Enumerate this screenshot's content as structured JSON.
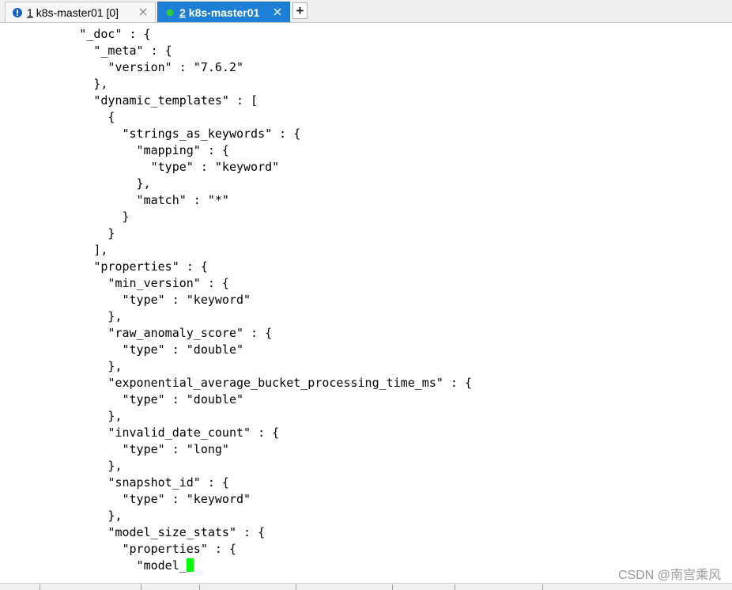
{
  "tabs": [
    {
      "number": "1",
      "label": "k8s-master01 [0]",
      "status_icon": "exclamation-info-icon",
      "status_color": "#1565c0",
      "active": false
    },
    {
      "number": "2",
      "label": "k8s-master01",
      "status_icon": "green-dot-icon",
      "status_color": "#2ecc40",
      "active": true
    }
  ],
  "new_tab_label": "+",
  "colors": {
    "active_tab": "#1e7fd6",
    "cursor": "#00ff00",
    "terminal_bg": "#ffffff",
    "terminal_fg": "#000000"
  },
  "terminal": {
    "lines": [
      "          \"_doc\" : {",
      "            \"_meta\" : {",
      "              \"version\" : \"7.6.2\"",
      "            },",
      "            \"dynamic_templates\" : [",
      "              {",
      "                \"strings_as_keywords\" : {",
      "                  \"mapping\" : {",
      "                    \"type\" : \"keyword\"",
      "                  },",
      "                  \"match\" : \"*\"",
      "                }",
      "              }",
      "            ],",
      "            \"properties\" : {",
      "              \"min_version\" : {",
      "                \"type\" : \"keyword\"",
      "              },",
      "              \"raw_anomaly_score\" : {",
      "                \"type\" : \"double\"",
      "              },",
      "              \"exponential_average_bucket_processing_time_ms\" : {",
      "                \"type\" : \"double\"",
      "              },",
      "              \"invalid_date_count\" : {",
      "                \"type\" : \"long\"",
      "              },",
      "              \"snapshot_id\" : {",
      "                \"type\" : \"keyword\"",
      "              },",
      "              \"model_size_stats\" : {",
      "                \"properties\" : {",
      "                  \"model_"
    ]
  },
  "watermark": "CSDN @南宫乘风"
}
